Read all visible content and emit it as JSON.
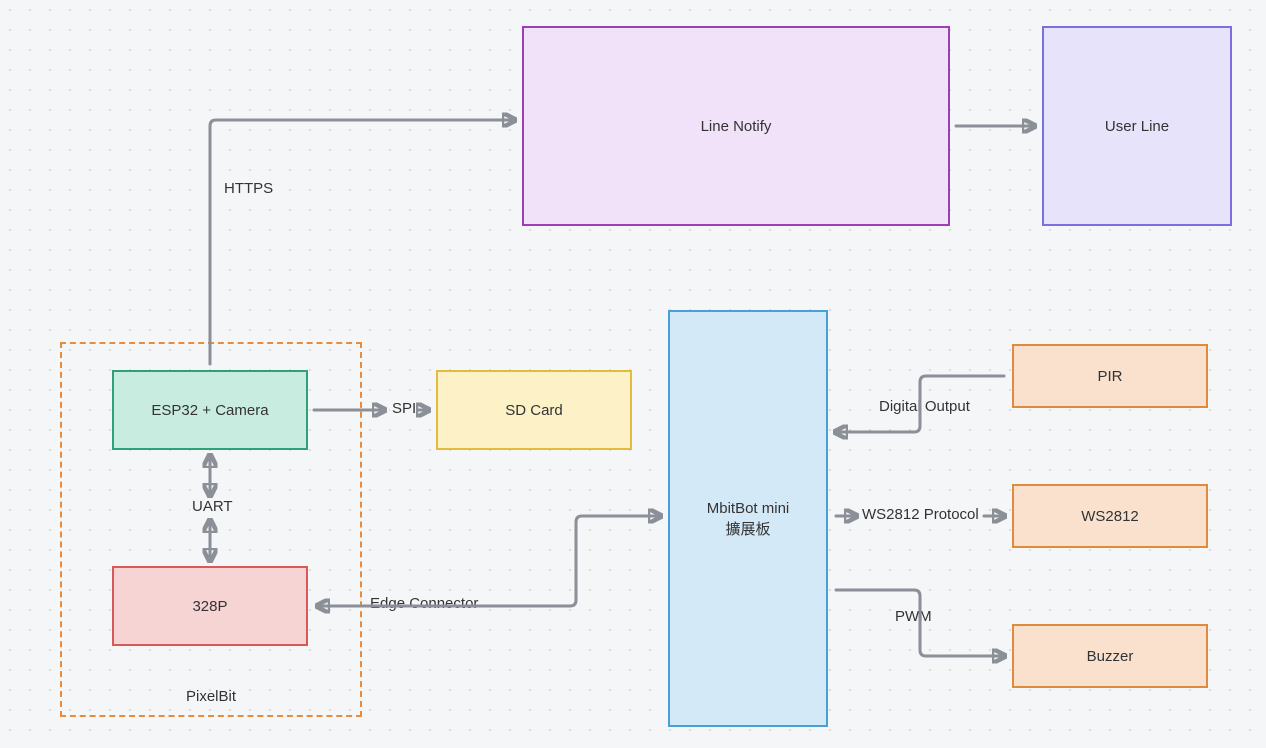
{
  "nodes": {
    "line_notify": "Line Notify",
    "user_line": "User Line",
    "esp32": "ESP32 + Camera",
    "sd_card": "SD Card",
    "p328": "328P",
    "mbitbot_line1": "MbitBot mini",
    "mbitbot_line2": "擴展板",
    "pir": "PIR",
    "ws2812": "WS2812",
    "buzzer": "Buzzer"
  },
  "group": {
    "pixelbit": "PixelBit"
  },
  "labels": {
    "https": "HTTPS",
    "spi": "SPI",
    "uart": "UART",
    "edge_connector": "Edge Connector",
    "digital_output": "Digital Output",
    "ws2812_protocol": "WS2812 Protocol",
    "pwm": "PWM"
  }
}
